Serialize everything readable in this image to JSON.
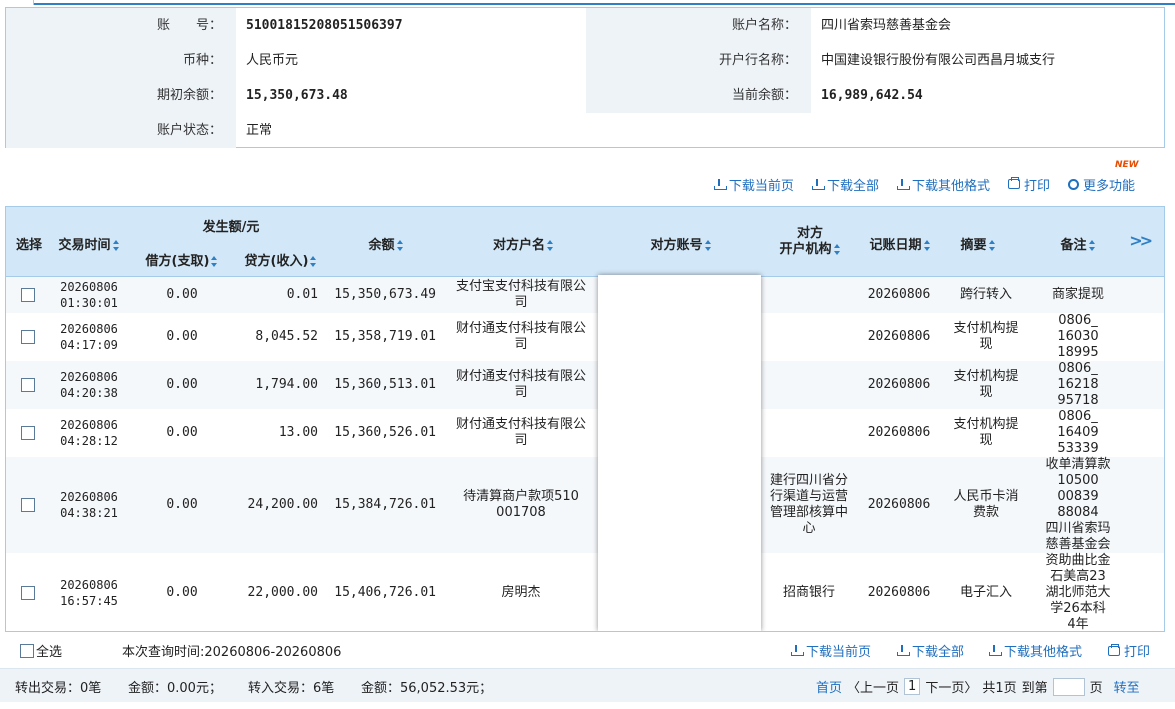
{
  "account": {
    "account_no_label": "账　　号：",
    "account_no": "51001815208051506397",
    "account_name_label": "账户名称：",
    "account_name": "四川省索玛慈善基金会",
    "currency_label": "币种：",
    "currency": "人民币元",
    "bank_label": "开户行名称：",
    "bank": "中国建设银行股份有限公司西昌月城支行",
    "opening_balance_label": "期初余额：",
    "opening_balance": "15,350,673.48",
    "current_balance_label": "当前余额：",
    "current_balance": "16,989,642.54",
    "status_label": "账户状态：",
    "status": "正常"
  },
  "toolbar": {
    "download_page": "下载当前页",
    "download_all": "下载全部",
    "download_other": "下载其他格式",
    "print": "打印",
    "more": "更多功能",
    "new_badge": "NEW"
  },
  "table": {
    "headers": {
      "select": "选择",
      "time": "交易时间",
      "amount_group": "发生额/元",
      "debit": "借方(支取)",
      "credit": "贷方(收入)",
      "balance": "余额",
      "counterparty_name": "对方户名",
      "counterparty_account": "对方账号",
      "counterparty_bank_line1": "对方",
      "counterparty_bank_line2": "开户机构",
      "post_date": "记账日期",
      "summary": "摘要",
      "remark": "备注",
      "more": ">>"
    },
    "rows": [
      {
        "date": "20260806",
        "time": "01:30:01",
        "debit": "0.00",
        "credit": "0.01",
        "balance": "15,350,673.49",
        "name": [
          "支付宝支付科技有限公",
          "司"
        ],
        "bank": [],
        "post_date": "20260806",
        "summary": [
          "跨行转入"
        ],
        "remark": [
          "商家提现"
        ]
      },
      {
        "date": "20260806",
        "time": "04:17:09",
        "debit": "0.00",
        "credit": "8,045.52",
        "balance": "15,358,719.01",
        "name": [
          "财付通支付科技有限公",
          "司"
        ],
        "bank": [],
        "post_date": "20260806",
        "summary": [
          "支付机构提",
          "现"
        ],
        "remark": [
          "0806_",
          "16030",
          "18995"
        ]
      },
      {
        "date": "20260806",
        "time": "04:20:38",
        "debit": "0.00",
        "credit": "1,794.00",
        "balance": "15,360,513.01",
        "name": [
          "财付通支付科技有限公",
          "司"
        ],
        "bank": [],
        "post_date": "20260806",
        "summary": [
          "支付机构提",
          "现"
        ],
        "remark": [
          "0806_",
          "16218",
          "95718"
        ]
      },
      {
        "date": "20260806",
        "time": "04:28:12",
        "debit": "0.00",
        "credit": "13.00",
        "balance": "15,360,526.01",
        "name": [
          "财付通支付科技有限公",
          "司"
        ],
        "bank": [],
        "post_date": "20260806",
        "summary": [
          "支付机构提",
          "现"
        ],
        "remark": [
          "0806_",
          "16409",
          "53339"
        ]
      },
      {
        "date": "20260806",
        "time": "04:38:21",
        "debit": "0.00",
        "credit": "24,200.00",
        "balance": "15,384,726.01",
        "name": [
          "待清算商户款项510",
          "001708"
        ],
        "bank": [
          "建行四川省分",
          "行渠道与运营",
          "管理部核算中",
          "心"
        ],
        "post_date": "20260806",
        "summary": [
          "人民币卡消",
          "费款"
        ],
        "remark": [
          "收单清算款",
          "10500",
          "00839",
          "88084",
          "四川省索玛",
          "慈善基金会"
        ]
      },
      {
        "date": "20260806",
        "time": "16:57:45",
        "debit": "0.00",
        "credit": "22,000.00",
        "balance": "15,406,726.01",
        "name": [
          "房明杰"
        ],
        "bank": [
          "招商银行"
        ],
        "post_date": "20260806",
        "summary": [
          "电子汇入"
        ],
        "remark": [
          "资助曲比金",
          "石美高23",
          "湖北师范大",
          "学26本科",
          "4年"
        ]
      }
    ]
  },
  "footer": {
    "select_all": "全选",
    "query_time": "本次查询时间:20260806-20260806",
    "download_page": "下载当前页",
    "download_all": "下载全部",
    "download_other": "下载其他格式",
    "print": "打印",
    "out_count": "转出交易：0笔",
    "out_amount": "金额：0.00元；",
    "in_count": "转入交易：6笔",
    "in_amount": "金额：56,052.53元；",
    "first": "首页",
    "prev": "〈上一页",
    "page": "1",
    "next": "下一页〉",
    "total": "共1页",
    "goto": "到第",
    "page_unit": "页",
    "go": "转至"
  }
}
